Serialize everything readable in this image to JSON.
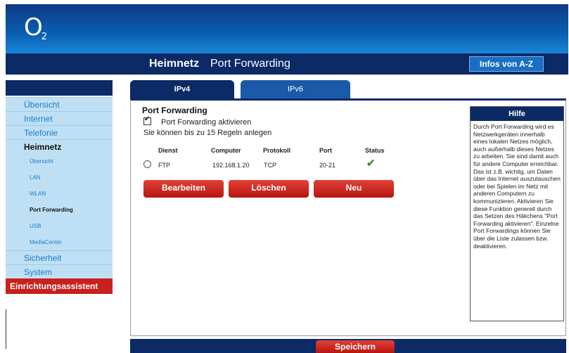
{
  "header": {
    "logo_text": "O",
    "logo_sub": "2",
    "section": "Heimnetz",
    "page": "Port Forwarding",
    "infos_label": "Infos von A-Z"
  },
  "sidebar": {
    "items": [
      {
        "label": "Übersicht"
      },
      {
        "label": "Internet"
      },
      {
        "label": "Telefonie"
      },
      {
        "label": "Heimnetz"
      },
      {
        "label": "Sicherheit"
      },
      {
        "label": "System"
      }
    ],
    "subitems": [
      {
        "label": "Übersicht"
      },
      {
        "label": "LAN"
      },
      {
        "label": "WLAN"
      },
      {
        "label": "Port Forwarding"
      },
      {
        "label": "USB"
      },
      {
        "label": "MediaCenter"
      }
    ],
    "wizard": "Einrichtungsassistent"
  },
  "tabs": [
    {
      "label": "IPv4"
    },
    {
      "label": "IPv6"
    }
  ],
  "main": {
    "title": "Port Forwarding",
    "checkbox_label": "Port Forwarding aktivieren",
    "checkbox_checked": true,
    "hint": "Sie können bis zu 15 Regeln anlegen",
    "columns": [
      "Dienst",
      "Computer",
      "Protokoll",
      "Port",
      "Status"
    ],
    "rows": [
      {
        "dienst": "FTP",
        "computer": "192.168.1.20",
        "protokoll": "TCP",
        "port": "20-21",
        "status": "active"
      }
    ],
    "buttons": {
      "edit": "Bearbeiten",
      "delete": "Löschen",
      "new": "Neu"
    }
  },
  "help": {
    "title": "Hilfe",
    "text": "Durch Port Forwarding wird es Netzwerkgeräten innerhalb eines lokalen Netzes möglich, auch außerhalb dieses Netzes zu arbeiten. Sie sind damit auch für andere Computer erreichbar. Das ist z.B. wichtig, um Daten über das Internet auszutauschen oder bei Spielen im Netz mit anderen Computern zu kommunizieren. Aktivieren Sie diese Funktion generell durch das Setzen des Häkchens \"Port Forwarding aktivieren\". Einzelne Port Forwardings können Sie über die Liste zulassen bzw. deaktivieren."
  },
  "footer": {
    "save_label": "Speichern"
  },
  "colors": {
    "brand_dark_blue": "#0b2a66",
    "banner_blue": "#0a5fb2",
    "nav_bg": "#bfe0f4",
    "nav_link": "#1e7cc8",
    "button_red": "#c8201c",
    "status_green": "#3a9a2a"
  }
}
